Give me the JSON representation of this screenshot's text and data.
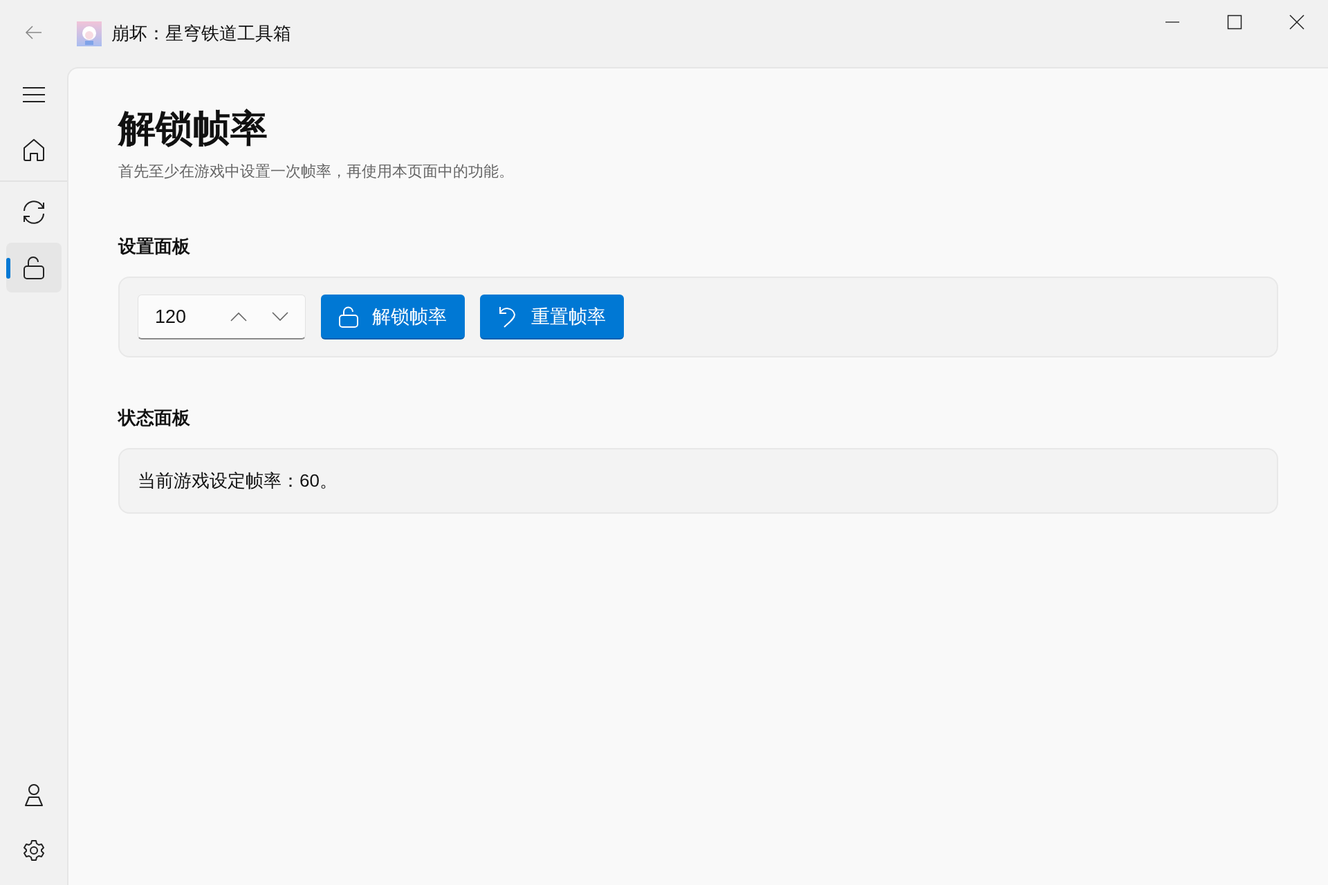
{
  "window": {
    "title": "崩坏：星穹铁道工具箱"
  },
  "sidebar": {
    "top_items": [
      {
        "selected": false
      },
      {
        "selected": false
      },
      {
        "selected": true
      }
    ],
    "bottom_items": [
      {
        "selected": false
      },
      {
        "selected": false
      }
    ]
  },
  "page": {
    "title": "解锁帧率",
    "subtitle": "首先至少在游戏中设置一次帧率，再使用本页面中的功能。"
  },
  "settings_panel": {
    "heading": "设置面板",
    "number_box": {
      "value": "120"
    },
    "buttons": [
      {
        "kind": "unlock",
        "label": "解锁帧率"
      },
      {
        "kind": "reset",
        "label": "重置帧率"
      }
    ]
  },
  "status_panel": {
    "heading": "状态面板",
    "text": "当前游戏设定帧率：60。"
  }
}
